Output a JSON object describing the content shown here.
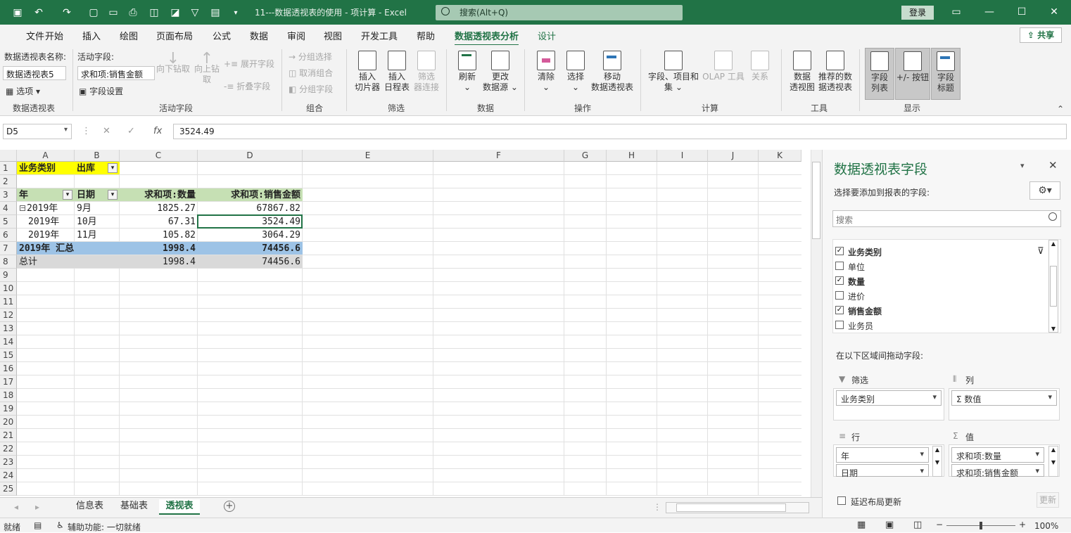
{
  "titlebar": {
    "doc_title": "11---数据透视表的使用 - 项计算 - Excel",
    "search_placeholder": "搜索(Alt+Q)",
    "login": "登录"
  },
  "menu_tabs": [
    "文件",
    "开始",
    "插入",
    "绘图",
    "页面布局",
    "公式",
    "数据",
    "审阅",
    "视图",
    "开发工具",
    "帮助",
    "数据透视表分析",
    "设计"
  ],
  "share": "共享",
  "ribbon": {
    "pivot_name_label": "数据透视表名称:",
    "pivot_name_value": "数据透视表5",
    "options": "选项",
    "group_pivot": "数据透视表",
    "active_field_label": "活动字段:",
    "active_field_value": "求和项:销售金额",
    "field_settings": "字段设置",
    "drill_down": "向下钻取",
    "drill_up": "向上钻",
    "drill_up2": "取",
    "expand": "展开字段",
    "collapse": "折叠字段",
    "group_active": "活动字段",
    "group_sel": "分组选择",
    "ungroup": "取消组合",
    "group_field": "分组字段",
    "group_group": "组合",
    "slicer1": "插入",
    "slicer2": "切片器",
    "timeline1": "插入",
    "timeline2": "日程表",
    "filterconn1": "筛选",
    "filterconn2": "器连接",
    "group_filter": "筛选",
    "refresh": "刷新",
    "change1": "更改",
    "change2": "数据源",
    "group_data": "数据",
    "clear": "清除",
    "select": "选择",
    "move1": "移动",
    "move2": "数据透视表",
    "group_actions": "操作",
    "fields1": "字段、项目和",
    "fields2": "集",
    "olap": "OLAP 工具",
    "relations": "关系",
    "group_calc": "计算",
    "chart1": "数据",
    "chart2": "透视图",
    "rec1": "推荐的数",
    "rec2": "据透视表",
    "group_tools": "工具",
    "fl1": "字段",
    "fl2": "列表",
    "pm": "+/- 按钮",
    "fh1": "字段",
    "fh2": "标题",
    "group_show": "显示"
  },
  "formula": {
    "namebox": "D5",
    "value": "3524.49"
  },
  "columns": [
    "A",
    "B",
    "C",
    "D",
    "E",
    "F",
    "G",
    "H",
    "I",
    "J",
    "K"
  ],
  "rows": [
    "1",
    "2",
    "3",
    "4",
    "5",
    "6",
    "7",
    "8",
    "9",
    "10",
    "11",
    "12",
    "13",
    "14",
    "15",
    "16",
    "17",
    "18",
    "19",
    "20",
    "21",
    "22",
    "23",
    "24",
    "25"
  ],
  "cells": {
    "a1": "业务类别",
    "b1": "出库",
    "a3": "年",
    "b3": "日期",
    "c3": "求和项:数量",
    "d3": "求和项:销售金额",
    "a4": "2019年",
    "b4": "9月",
    "c4": "1825.27",
    "d4": "67867.82",
    "a5": "2019年",
    "b5": "10月",
    "c5": "67.31",
    "d5": "3524.49",
    "a6": "2019年",
    "b6": "11月",
    "c6": "105.82",
    "d6": "3064.29",
    "a7": "2019年 汇总",
    "c7": "1998.4",
    "d7": "74456.6",
    "a8": "总计",
    "c8": "1998.4",
    "d8": "74456.6"
  },
  "sheets": [
    "信息表",
    "基础表",
    "透视表"
  ],
  "status": {
    "ready": "就绪",
    "access": "辅助功能: 一切就绪",
    "zoom": "100%"
  },
  "panel": {
    "title": "数据透视表字段",
    "subtitle": "选择要添加到报表的字段:",
    "search_placeholder": "搜索",
    "fields": [
      {
        "name": "业务类别",
        "checked": true
      },
      {
        "name": "单位",
        "checked": false
      },
      {
        "name": "数量",
        "checked": true
      },
      {
        "name": "进价",
        "checked": false
      },
      {
        "name": "销售金额",
        "checked": true
      },
      {
        "name": "业务员",
        "checked": false
      }
    ],
    "drag_label": "在以下区域间拖动字段:",
    "filter_label": "筛选",
    "column_label": "列",
    "row_label": "行",
    "value_label": "值",
    "filter_item": "业务类别",
    "column_item": "Σ 数值",
    "row_items": [
      "年",
      "日期"
    ],
    "value_items": [
      "求和项:数量",
      "求和项:销售金额"
    ],
    "defer": "延迟布局更新",
    "update": "更新"
  }
}
